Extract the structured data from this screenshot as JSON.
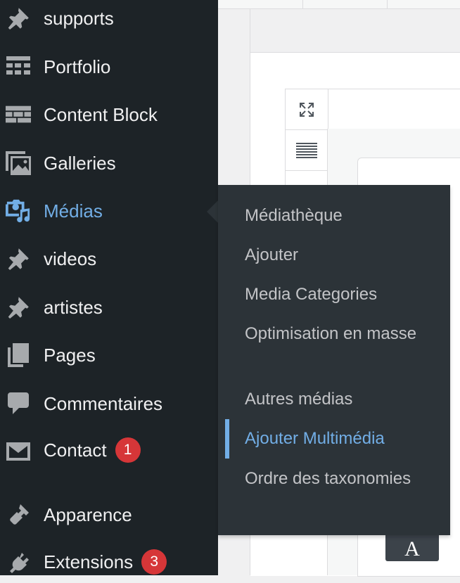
{
  "sidebar": {
    "items": [
      {
        "label": "supports",
        "icon": "pin-icon"
      },
      {
        "label": "Portfolio",
        "icon": "portfolio-icon"
      },
      {
        "label": "Content Block",
        "icon": "content-block-icon"
      },
      {
        "label": "Galleries",
        "icon": "gallery-icon"
      },
      {
        "label": "Médias",
        "icon": "media-icon",
        "active": true
      },
      {
        "label": "videos",
        "icon": "pin-icon"
      },
      {
        "label": "artistes",
        "icon": "pin-icon"
      },
      {
        "label": "Pages",
        "icon": "pages-icon"
      },
      {
        "label": "Commentaires",
        "icon": "comment-icon"
      },
      {
        "label": "Contact",
        "icon": "mail-icon",
        "badge": "1"
      },
      {
        "label": "Apparence",
        "icon": "brush-icon"
      },
      {
        "label": "Extensions",
        "icon": "plugin-icon",
        "badge": "3"
      }
    ]
  },
  "submenu": {
    "items": [
      {
        "label": "Médiathèque"
      },
      {
        "label": "Ajouter"
      },
      {
        "label": "Media Categories"
      },
      {
        "label": "Optimisation en masse"
      },
      {
        "label": "Autres médias"
      },
      {
        "label": "Ajouter Multimédia",
        "current": true
      },
      {
        "label": "Ordre des taxonomies"
      }
    ]
  },
  "editor": {
    "font_button_label": "A",
    "fullscreen_icon": "expand-icon",
    "text_icon": "lines-icon"
  },
  "colors": {
    "sidebar_bg": "#1d2327",
    "flyout_bg": "#2c3338",
    "accent": "#72aee6",
    "badge": "#d63638"
  }
}
